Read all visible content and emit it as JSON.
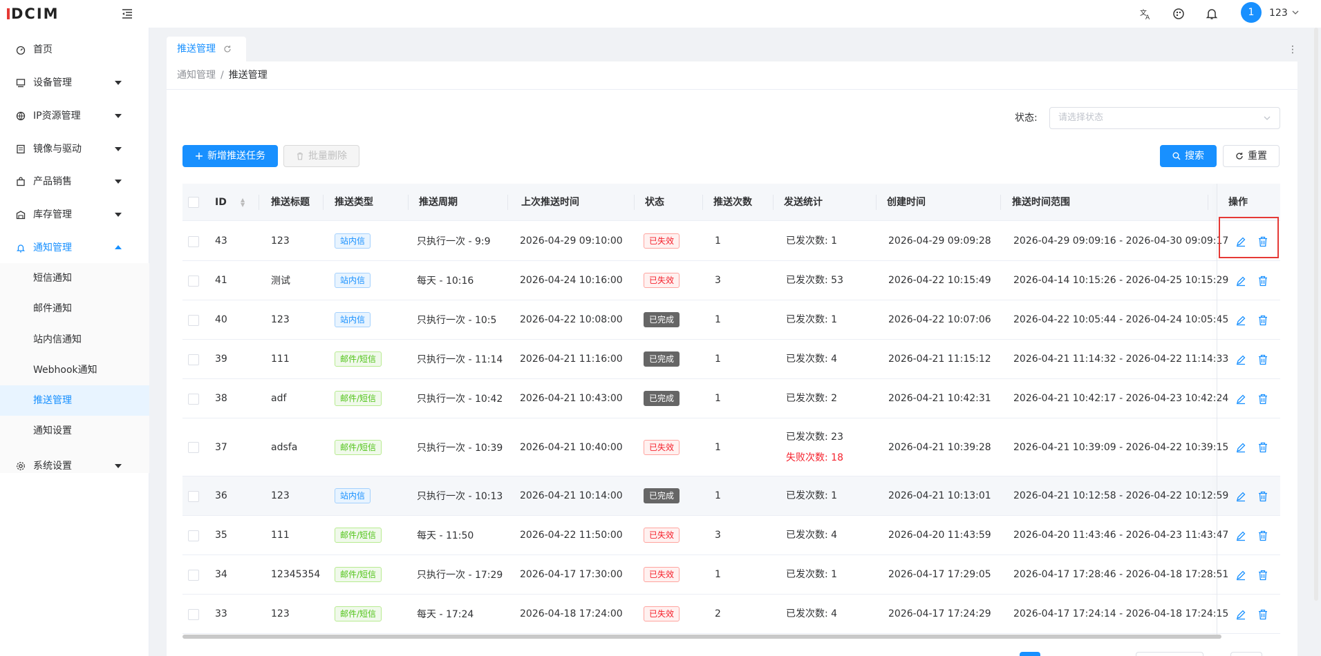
{
  "app": {
    "logo_text": "DCIM"
  },
  "header": {
    "user_avatar_text": "1",
    "username": "123",
    "icons": [
      "translate-icon",
      "theme-icon",
      "bell-icon"
    ]
  },
  "sidebar": {
    "items": [
      {
        "label": "首页",
        "icon": "dashboard-icon",
        "has_caret": false
      },
      {
        "label": "设备管理",
        "icon": "device-icon",
        "has_caret": true
      },
      {
        "label": "IP资源管理",
        "icon": "network-icon",
        "has_caret": true
      },
      {
        "label": "镜像与驱动",
        "icon": "image-icon",
        "has_caret": true
      },
      {
        "label": "产品销售",
        "icon": "bag-icon",
        "has_caret": true
      },
      {
        "label": "库存管理",
        "icon": "warehouse-icon",
        "has_caret": true
      },
      {
        "label": "通知管理",
        "icon": "bell-icon",
        "has_caret": true,
        "open": true
      },
      {
        "label": "系统设置",
        "icon": "gear-icon",
        "has_caret": true
      }
    ],
    "sub_items": [
      {
        "label": "短信通知"
      },
      {
        "label": "邮件通知"
      },
      {
        "label": "站内信通知"
      },
      {
        "label": "Webhook通知"
      },
      {
        "label": "推送管理",
        "active": true
      },
      {
        "label": "通知设置"
      }
    ]
  },
  "tabs": [
    {
      "label": "推送管理",
      "active": true
    }
  ],
  "breadcrumb": {
    "parent": "通知管理",
    "separator": "/",
    "current": "推送管理"
  },
  "filter": {
    "status_label": "状态:",
    "status_placeholder": "请选择状态"
  },
  "toolbar": {
    "add_label": "新增推送任务",
    "batch_delete_label": "批量删除",
    "search_label": "搜索",
    "reset_label": "重置"
  },
  "table": {
    "columns": [
      "ID",
      "推送标题",
      "推送类型",
      "推送周期",
      "上次推送时间",
      "状态",
      "推送次数",
      "发送统计",
      "创建时间",
      "推送时间范围",
      "操作"
    ],
    "rows": [
      {
        "id": "43",
        "title": "123",
        "type": "站内信",
        "type_color": "blue",
        "cycle": "只执行一次 - 9:9",
        "last": "2026-04-29 09:10:00",
        "status": "已失效",
        "status_color": "red",
        "count": "1",
        "stats": [
          "已发次数: 1"
        ],
        "created": "2026-04-29 09:09:28",
        "range": "2026-04-29 09:09:16 - 2026-04-30 09:09:17"
      },
      {
        "id": "41",
        "title": "测试",
        "type": "站内信",
        "type_color": "blue",
        "cycle": "每天 - 10:16",
        "last": "2026-04-24 10:16:00",
        "status": "已失效",
        "status_color": "red",
        "count": "3",
        "stats": [
          "已发次数: 53"
        ],
        "created": "2026-04-22 10:15:49",
        "range": "2026-04-14 10:15:26 - 2026-04-25 10:15:29"
      },
      {
        "id": "40",
        "title": "123",
        "type": "站内信",
        "type_color": "blue",
        "cycle": "只执行一次 - 10:5",
        "last": "2026-04-22 10:08:00",
        "status": "已完成",
        "status_color": "dark",
        "count": "1",
        "stats": [
          "已发次数: 1"
        ],
        "created": "2026-04-22 10:07:06",
        "range": "2026-04-22 10:05:44 - 2026-04-24 10:05:45"
      },
      {
        "id": "39",
        "title": "111",
        "type": "邮件/短信",
        "type_color": "green",
        "cycle": "只执行一次 - 11:14",
        "last": "2026-04-21 11:16:00",
        "status": "已完成",
        "status_color": "dark",
        "count": "1",
        "stats": [
          "已发次数: 4"
        ],
        "created": "2026-04-21 11:15:12",
        "range": "2026-04-21 11:14:32 - 2026-04-22 11:14:33"
      },
      {
        "id": "38",
        "title": "adf",
        "type": "邮件/短信",
        "type_color": "green",
        "cycle": "只执行一次 - 10:42",
        "last": "2026-04-21 10:43:00",
        "status": "已完成",
        "status_color": "dark",
        "count": "1",
        "stats": [
          "已发次数: 2"
        ],
        "created": "2026-04-21 10:42:31",
        "range": "2026-04-21 10:42:17 - 2026-04-23 10:42:24"
      },
      {
        "id": "37",
        "title": "adsfa",
        "type": "邮件/短信",
        "type_color": "green",
        "cycle": "只执行一次 - 10:39",
        "last": "2026-04-21 10:40:00",
        "status": "已失效",
        "status_color": "red",
        "count": "1",
        "stats": [
          "已发次数: 23",
          "失败次数: 18"
        ],
        "created": "2026-04-21 10:39:28",
        "range": "2026-04-21 10:39:09 - 2026-04-22 10:39:15"
      },
      {
        "id": "36",
        "title": "123",
        "type": "站内信",
        "type_color": "blue",
        "cycle": "只执行一次 - 10:13",
        "last": "2026-04-21 10:14:00",
        "status": "已完成",
        "status_color": "dark",
        "count": "1",
        "stats": [
          "已发次数: 1"
        ],
        "created": "2026-04-21 10:13:01",
        "range": "2026-04-21 10:12:58 - 2026-04-22 10:12:59"
      },
      {
        "id": "35",
        "title": "111",
        "type": "邮件/短信",
        "type_color": "green",
        "cycle": "每天 - 11:50",
        "last": "2026-04-22 11:50:00",
        "status": "已失效",
        "status_color": "red",
        "count": "3",
        "stats": [
          "已发次数: 4"
        ],
        "created": "2026-04-20 11:43:59",
        "range": "2026-04-20 11:43:46 - 2026-04-23 11:43:47"
      },
      {
        "id": "34",
        "title": "12345354",
        "type": "邮件/短信",
        "type_color": "green",
        "cycle": "只执行一次 - 17:29",
        "last": "2026-04-17 17:30:00",
        "status": "已失效",
        "status_color": "red",
        "count": "1",
        "stats": [
          "已发次数: 1"
        ],
        "created": "2026-04-17 17:29:05",
        "range": "2026-04-17 17:28:46 - 2026-04-18 17:28:51"
      },
      {
        "id": "33",
        "title": "123",
        "type": "邮件/短信",
        "type_color": "green",
        "cycle": "每天 - 17:24",
        "last": "2026-04-18 17:24:00",
        "status": "已失效",
        "status_color": "red",
        "count": "2",
        "stats": [
          "已发次数: 4"
        ],
        "created": "2026-04-17 17:24:29",
        "range": "2026-04-17 17:24:14 - 2026-04-18 17:24:15"
      }
    ]
  },
  "colors": {
    "primary": "#1890ff",
    "danger": "#f5222d",
    "success": "#52c41a",
    "highlight_border": "#e53935"
  }
}
